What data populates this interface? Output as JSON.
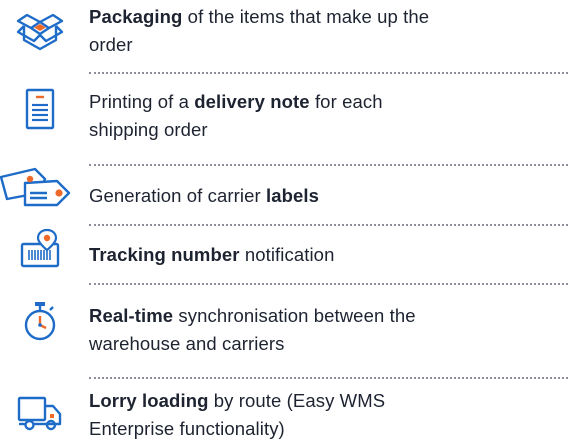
{
  "colors": {
    "icon_blue": "#1e6cc8",
    "accent_orange": "#ee6a2a",
    "text": "#1d2330",
    "divider": "#8a8f99"
  },
  "items": [
    {
      "icon": "packaging-box-icon",
      "line1": [
        {
          "t": "Packaging",
          "b": true
        },
        {
          "t": " of the items that make up the",
          "b": false
        }
      ],
      "line2": [
        {
          "t": "order",
          "b": false
        }
      ]
    },
    {
      "icon": "document-icon",
      "line1": [
        {
          "t": "Printing of a ",
          "b": false
        },
        {
          "t": "delivery note",
          "b": true
        },
        {
          "t": " for each",
          "b": false
        }
      ],
      "line2": [
        {
          "t": "shipping order",
          "b": false
        }
      ]
    },
    {
      "icon": "tags-icon",
      "line1": [
        {
          "t": "Generation of carrier ",
          "b": false
        },
        {
          "t": "labels",
          "b": true
        }
      ],
      "line2": []
    },
    {
      "icon": "barcode-location-icon",
      "line1": [
        {
          "t": "Tracking number",
          "b": true
        },
        {
          "t": " notification",
          "b": false
        }
      ],
      "line2": []
    },
    {
      "icon": "stopwatch-icon",
      "line1": [
        {
          "t": "Real-time",
          "b": true
        },
        {
          "t": " synchronisation between the",
          "b": false
        }
      ],
      "line2": [
        {
          "t": "warehouse and carriers",
          "b": false
        }
      ]
    },
    {
      "icon": "lorry-icon",
      "line1": [
        {
          "t": "Lorry loading",
          "b": true
        },
        {
          "t": " by route (Easy WMS",
          "b": false
        }
      ],
      "line2": [
        {
          "t": "Enterprise functionality)",
          "b": false
        }
      ]
    }
  ]
}
